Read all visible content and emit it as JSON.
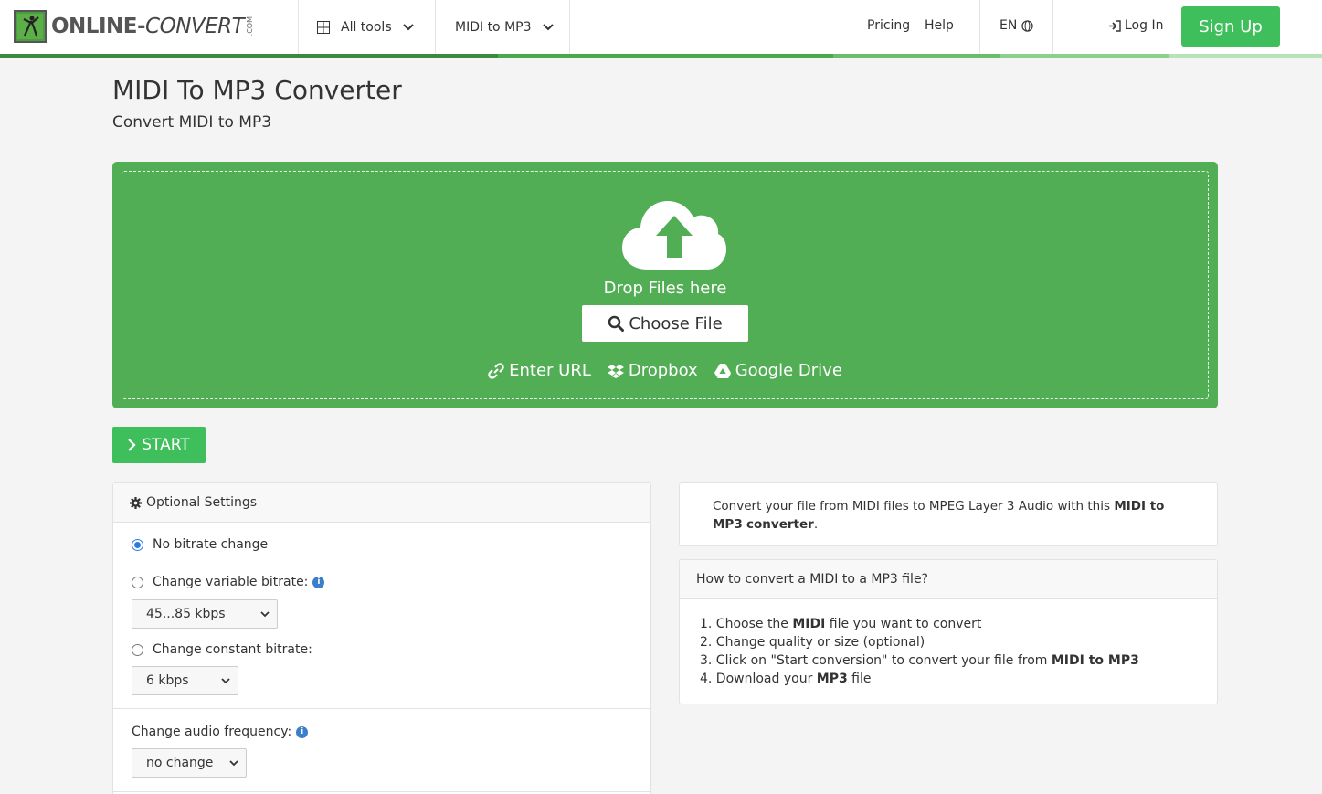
{
  "header": {
    "logo_main": "ONLINE-",
    "logo_alt": "CONVERT",
    "logo_com": ".COM",
    "all_tools": "All tools",
    "converter_menu": "MIDI to MP3",
    "pricing": "Pricing",
    "help": "Help",
    "language": "EN",
    "login": "Log In",
    "signup": "Sign Up"
  },
  "page": {
    "title": "MIDI To MP3 Converter",
    "subtitle": "Convert MIDI to MP3"
  },
  "dropzone": {
    "drop_text": "Drop Files here",
    "choose_file": "Choose File",
    "enter_url": "Enter URL",
    "dropbox": "Dropbox",
    "google_drive": "Google Drive"
  },
  "start_button": "START",
  "settings": {
    "title": "Optional Settings",
    "no_bitrate": "No bitrate change",
    "variable_bitrate": "Change variable bitrate:",
    "variable_value": "45...85 kbps",
    "constant_bitrate": "Change constant bitrate:",
    "constant_value": "6 kbps",
    "frequency_label": "Change audio frequency:",
    "frequency_value": "no change",
    "selected_option": "No bitrate change"
  },
  "description": {
    "pre": "Convert your file from MIDI files to MPEG Layer 3 Audio with this ",
    "bold": "MIDI to MP3",
    "bold2": "converter",
    "post": "."
  },
  "howto": {
    "title": "How to convert a MIDI to a MP3 file?",
    "step1_a": "1. Choose the ",
    "step1_b": "MIDI",
    "step1_c": " file you want to convert",
    "step2": "2. Change quality or size (optional)",
    "step3_a": "3. Click on \"Start conversion\" to convert your file from ",
    "step3_b": "MIDI to MP3",
    "step4_a": "4. Download your ",
    "step4_b": "MP3",
    "step4_c": " file"
  },
  "colors": {
    "brand_green": "#3fbf5b",
    "dropzone_green": "#52ae55",
    "radio_blue": "#2a7ae2"
  }
}
